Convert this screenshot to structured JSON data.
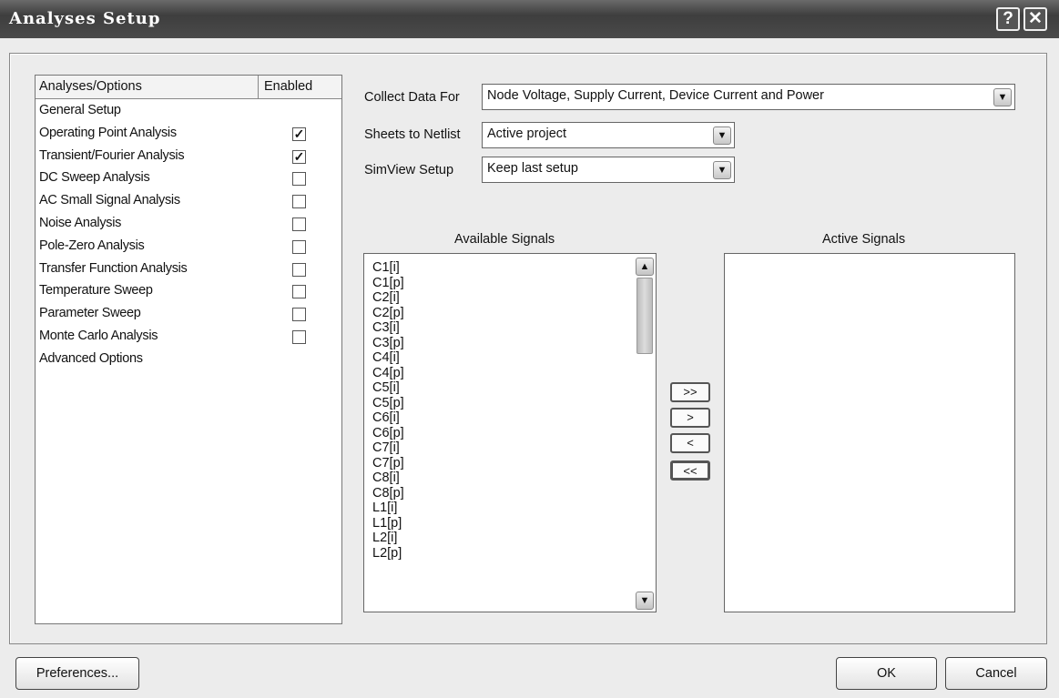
{
  "window": {
    "title": "Analyses Setup",
    "help_label": "?",
    "close_label": "✕"
  },
  "analyses": {
    "header_name": "Analyses/Options",
    "header_enabled": "Enabled",
    "items": [
      {
        "label": "General Setup",
        "checkbox": false
      },
      {
        "label": "Operating Point Analysis",
        "checkbox": true,
        "checked": true
      },
      {
        "label": "Transient/Fourier Analysis",
        "checkbox": true,
        "checked": true
      },
      {
        "label": "DC Sweep Analysis",
        "checkbox": true,
        "checked": false
      },
      {
        "label": "AC Small Signal Analysis",
        "checkbox": true,
        "checked": false
      },
      {
        "label": "Noise Analysis",
        "checkbox": true,
        "checked": false
      },
      {
        "label": "Pole-Zero Analysis",
        "checkbox": true,
        "checked": false
      },
      {
        "label": "Transfer Function Analysis",
        "checkbox": true,
        "checked": false
      },
      {
        "label": "Temperature Sweep",
        "checkbox": true,
        "checked": false
      },
      {
        "label": "Parameter Sweep",
        "checkbox": true,
        "checked": false
      },
      {
        "label": "Monte Carlo Analysis",
        "checkbox": true,
        "checked": false
      },
      {
        "label": "Advanced Options",
        "checkbox": false
      }
    ]
  },
  "settings": {
    "collect_label": "Collect Data For",
    "collect_value": "Node Voltage, Supply Current, Device Current and Power",
    "sheets_label": "Sheets to Netlist",
    "sheets_value": "Active project",
    "simview_label": "SimView Setup",
    "simview_value": "Keep last setup"
  },
  "available": {
    "label": "Available Signals",
    "items": [
      "C1[i]",
      "C1[p]",
      "C2[i]",
      "C2[p]",
      "C3[i]",
      "C3[p]",
      "C4[i]",
      "C4[p]",
      "C5[i]",
      "C5[p]",
      "C6[i]",
      "C6[p]",
      "C7[i]",
      "C7[p]",
      "C8[i]",
      "C8[p]",
      "L1[i]",
      "L1[p]",
      "L2[i]",
      "L2[p]"
    ]
  },
  "active": {
    "label": "Active Signals",
    "items": []
  },
  "move": {
    "add_all": ">>",
    "add": ">",
    "remove": "<",
    "remove_all": "<<"
  },
  "footer": {
    "preferences": "Preferences...",
    "ok": "OK",
    "cancel": "Cancel"
  }
}
